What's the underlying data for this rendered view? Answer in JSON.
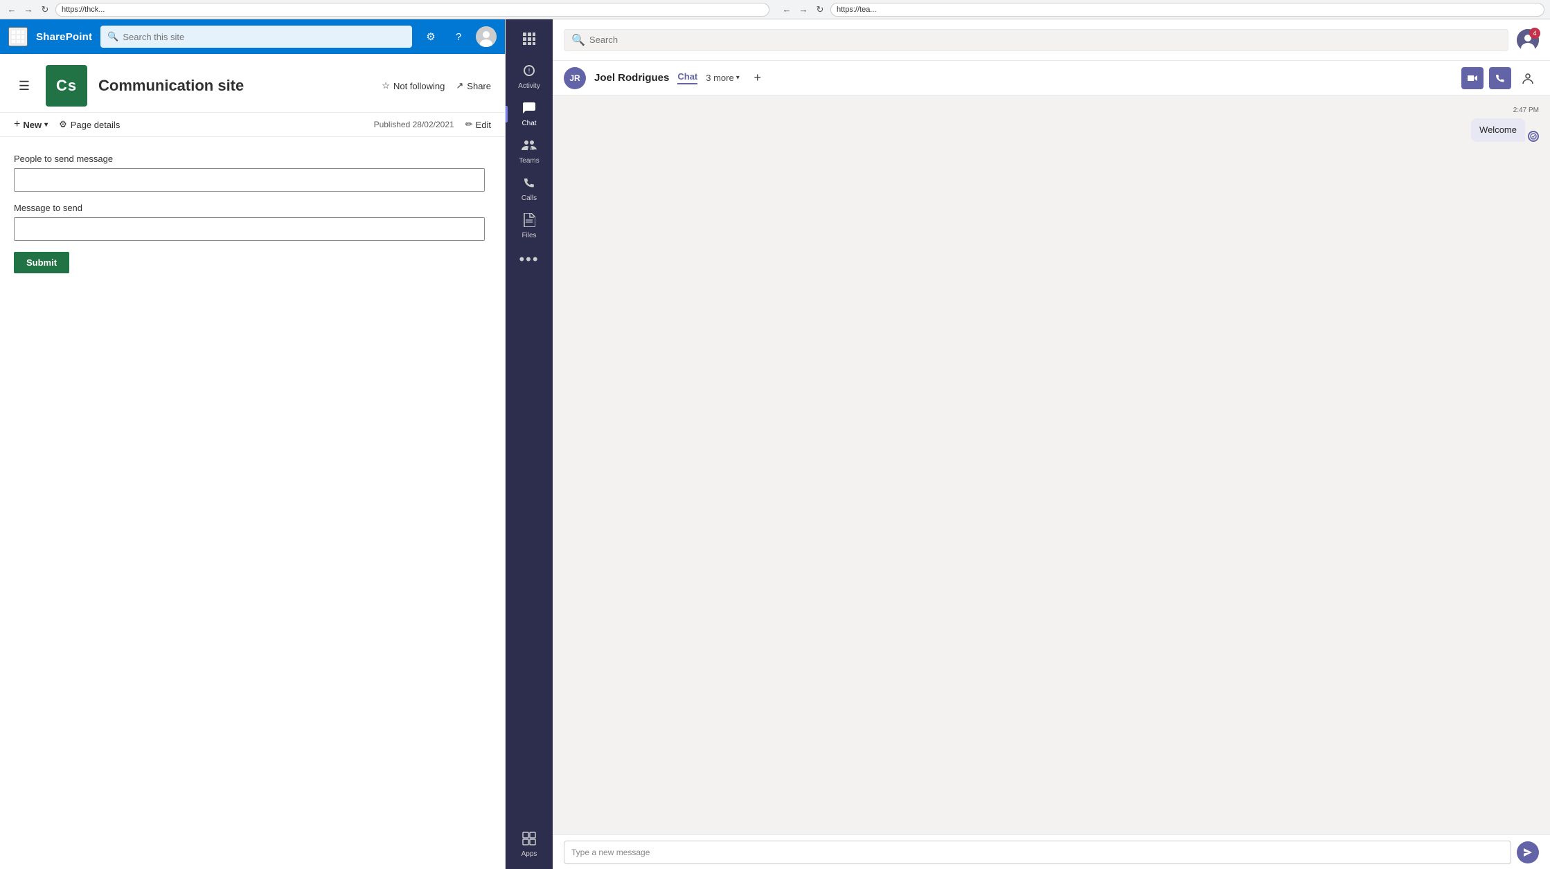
{
  "browser": {
    "left_url": "https://thck...",
    "right_url": "https://tea...",
    "left_favicon": "🔵",
    "right_favicon": "🟣"
  },
  "sharepoint": {
    "logo_text": "SharePoint",
    "search_placeholder": "Search this site",
    "site_logo_text": "Cs",
    "site_name": "Communication site",
    "follow_label": "Not following",
    "share_label": "Share",
    "new_label": "New",
    "page_details_label": "Page details",
    "published_text": "Published 28/02/2021",
    "edit_label": "Edit",
    "form": {
      "people_label": "People to send message",
      "message_label": "Message to send",
      "people_placeholder": "",
      "message_placeholder": "",
      "submit_label": "Submit"
    }
  },
  "teams": {
    "search_placeholder": "Search",
    "sidebar": {
      "items": [
        {
          "id": "activity",
          "label": "Activity",
          "icon": "🔔",
          "badge": null
        },
        {
          "id": "chat",
          "label": "Chat",
          "icon": "💬",
          "badge": null
        },
        {
          "id": "teams",
          "label": "Teams",
          "icon": "👥",
          "badge": null
        },
        {
          "id": "calls",
          "label": "Calls",
          "icon": "📞",
          "badge": null
        },
        {
          "id": "files",
          "label": "Files",
          "icon": "📄",
          "badge": null
        },
        {
          "id": "more",
          "label": "···",
          "icon": "•••",
          "badge": null
        },
        {
          "id": "apps",
          "label": "Apps",
          "icon": "🏪",
          "badge": null
        }
      ]
    },
    "notification_count": "4",
    "contact": {
      "name": "Joel Rodrigues",
      "initials": "JR",
      "active_tab": "Chat",
      "more_label": "3 more"
    },
    "message": {
      "time": "2:47 PM",
      "text": "Welcome",
      "status_icon": "✓"
    }
  }
}
